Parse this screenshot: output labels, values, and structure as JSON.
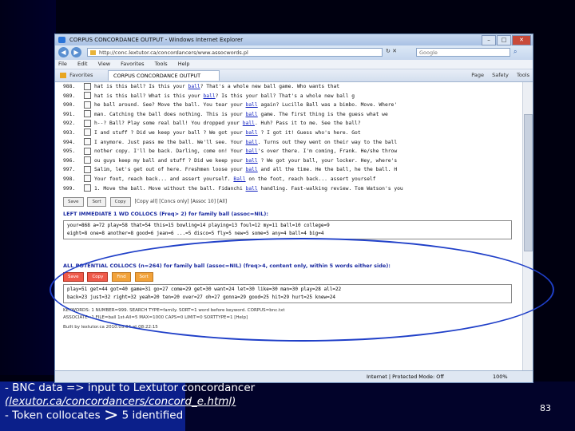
{
  "browser": {
    "title": "CORPUS CONCORDANCE OUTPUT - Windows Internet Explorer",
    "address": "http://conc.lextutor.ca/concordancers/www.assocwords.pl",
    "search_placeholder": "Google",
    "menu": [
      "File",
      "Edit",
      "View",
      "Favorites",
      "Tools",
      "Help"
    ],
    "favorites_label": "Favorites",
    "tab_label": "CORPUS CONCORDANCE OUTPUT",
    "tools": [
      "Page",
      "Safety",
      "Tools"
    ],
    "status_zone": "Internet | Protected Mode: Off",
    "zoom": "100%"
  },
  "concordance": [
    {
      "num": "988.",
      "left": "hat is this ball? Is this your",
      "kw": "ball",
      "right": "? That's a whole new ball game. Who wants that"
    },
    {
      "num": "989.",
      "left": "hat is this ball? What is this your",
      "kw": "ball",
      "right": "? Is this your ball? That's a whole new ball g"
    },
    {
      "num": "990.",
      "left": "he ball around. See? Move the ball. You tear your",
      "kw": "ball",
      "right": " again? Lucille Ball was a bimbo. Move. Where'"
    },
    {
      "num": "991.",
      "left": "man. Catching the ball does nothing. This is your",
      "kw": "ball",
      "right": " game. The first thing is the guess what we"
    },
    {
      "num": "992.",
      "left": "h--? Ball? Play some real ball! You dropped your",
      "kw": "ball",
      "right": ". Huh? Pass it to me. See the ball?"
    },
    {
      "num": "993.",
      "left": "I and stuff ? Did we keep your ball ? We got your",
      "kw": "ball",
      "right": " ? I got it! Guess who's here. Got"
    },
    {
      "num": "994.",
      "left": "I anymore. Just pass me the ball. We'll see. Your",
      "kw": "ball",
      "right": ". Turns out they went on their way to the ball"
    },
    {
      "num": "995.",
      "left": "nother copy. I'll be back. Darling, come on! Your",
      "kw": "ball",
      "right": "'s over there. I'm coming, Frank. He/she throw"
    },
    {
      "num": "996.",
      "left": "ou guys keep my ball and stuff ? Did we keep your",
      "kw": "ball",
      "right": " ? We got your ball, your locker. Hey, where's"
    },
    {
      "num": "997.",
      "left": "Salim, let's get out of here. Freshmen loose your",
      "kw": "ball",
      "right": " and all the time. He the ball, he the ball. H"
    },
    {
      "num": "998.",
      "left": "Your foot, reach back... and assert yourself.",
      "kw": "Ball",
      "right": " on the foot, reach back... assert yourself"
    },
    {
      "num": "999.",
      "left": "1. Move the ball. Move without the ball. Fidanchi",
      "kw": "ball",
      "right": " handling. Fast-walking review. Tom Watson's you"
    }
  ],
  "controls": {
    "buttons": [
      "Save",
      "Sort",
      "Copy"
    ],
    "links": "[Copy all] [Concs only] [Assoc 10] [All]"
  },
  "immediate": {
    "header": "LEFT IMMEDIATE 1 WD COLLOCS (Freq> 2) for family ball (assoc=NIL):",
    "line1": "your=868 a=72 play=58 that=54 this=15 bowling=14 playing=13 foul=12 my=11 ball=10 college=9",
    "line2": "eight=8 one=8 another=8 good=6 jean=6 ...=5 disco=5 fly=5 new=5 some=5 any=4 ball=4 big=4"
  },
  "potential": {
    "header": "ALL POTENTIAL COLLOCS (n=264) for family ball (assoc=NIL) (freq>4, content only, within 5 words either side):",
    "buttons": [
      "Save",
      "Copy",
      "Find",
      "Sort"
    ],
    "line1": "play=51 get=44 got=40 game=31 go=27 come=29 get=30 want=24 let=30 like=30 man=30 play=28 all=22",
    "line2": "back=23 just=32 right=32 yeah=20 ten=20 over=27 oh=27 gonna=29 good=25 hit=29 hurt=25 knew=24"
  },
  "footer_lines": [
    "KEYWORDS: 1 NUMBER=999. SEARCH TYPE=family. SORT=1 word before keyword. CORPUS=bnc.txt",
    "ASSOCIATE=1 FILE=ball 1st-All=5 MAX=1000 CAPS=0 LIMIT=0 SORTTYPE=1 [Help]"
  ],
  "footer_date": "Built by lextutor.ca 2010.03.04 at 08:22:15",
  "slide": {
    "caption_line1": "- BNC data => input to Lextutor concordancer",
    "caption_link": "(lexutor.ca/concordancers/concord_e.html)",
    "caption_line3_a": "- Token collocates",
    "caption_gt": ">",
    "caption_line3_b": "5 identified",
    "page_number": "83"
  }
}
